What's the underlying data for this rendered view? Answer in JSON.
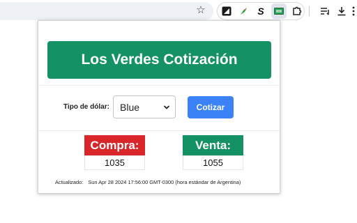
{
  "browser": {
    "extension_icons": [
      "screenshot-icon",
      "feather-icon",
      "dollar-s-icon",
      "los-verdes-extension-icon",
      "puzzle-icon"
    ],
    "right_icons": [
      "reading-list-icon",
      "download-icon",
      "more-icon"
    ],
    "accent_active_bg": "#dfe3ea"
  },
  "popup": {
    "title": "Los Verdes Cotización",
    "dollar_type_label": "Tipo de dólar:",
    "dollar_type_selected": "Blue",
    "quote_button": "Cotizar",
    "buy_label": "Compra:",
    "buy_value": "1035",
    "sell_label": "Venta:",
    "sell_value": "1055",
    "updated_label": "Actualizado:",
    "updated_value": "Sun Apr 28 2024 17:56:00 GMT-0300 (hora estándar de Argentina)"
  },
  "colors": {
    "banner_green": "#149263",
    "buy_red": "#d8262b",
    "button_blue": "#3b82f6"
  }
}
